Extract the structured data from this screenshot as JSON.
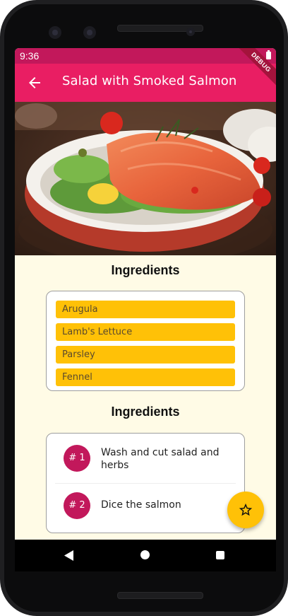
{
  "status_bar": {
    "time": "9:36"
  },
  "app_bar": {
    "title": "Salad with Smoked Salmon",
    "debug_banner": "DEBUG"
  },
  "hero_image": {
    "description": "smoked-salmon-salad-photo"
  },
  "ingredients_section": {
    "heading": "Ingredients",
    "items": [
      "Arugula",
      "Lamb's Lettuce",
      "Parsley",
      "Fennel"
    ]
  },
  "steps_section": {
    "heading": "Ingredients",
    "steps": [
      {
        "badge": "# 1",
        "text": "Wash and cut salad and herbs"
      },
      {
        "badge": "# 2",
        "text": "Dice the salmon"
      }
    ]
  },
  "fab": {
    "icon": "star-outline-icon"
  },
  "colors": {
    "primary": "#e91e63",
    "status_bar": "#c2185b",
    "accent": "#ffc107",
    "background": "#fffbe6"
  }
}
